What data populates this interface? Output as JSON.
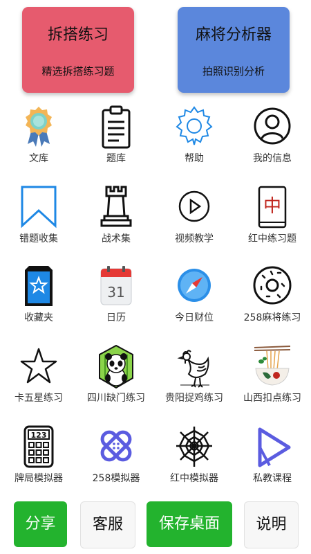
{
  "hero": {
    "left": {
      "title": "拆搭练习",
      "subtitle": "精选拆搭练习题",
      "color": "#e65b6e"
    },
    "right": {
      "title": "麻将分析器",
      "subtitle": "拍照识别分析",
      "color": "#5b87dc"
    }
  },
  "grid": {
    "items": [
      {
        "label": "文库",
        "icon": "award-ribbon-icon"
      },
      {
        "label": "题库",
        "icon": "clipboard-icon"
      },
      {
        "label": "帮助",
        "icon": "gear-icon"
      },
      {
        "label": "我的信息",
        "icon": "user-avatar-icon"
      },
      {
        "label": "错题收集",
        "icon": "bookmark-icon"
      },
      {
        "label": "战术集",
        "icon": "chess-rook-icon"
      },
      {
        "label": "视频教学",
        "icon": "play-circle-icon"
      },
      {
        "label": "红中练习题",
        "icon": "mahjong-tile-icon"
      },
      {
        "label": "收藏夹",
        "icon": "star-card-icon"
      },
      {
        "label": "日历",
        "icon": "calendar-icon"
      },
      {
        "label": "今日财位",
        "icon": "compass-icon"
      },
      {
        "label": "258麻将练习",
        "icon": "donut-icon"
      },
      {
        "label": "卡五星练习",
        "icon": "star-outline-icon"
      },
      {
        "label": "四川缺门练习",
        "icon": "panda-icon"
      },
      {
        "label": "贵阳捉鸡练习",
        "icon": "rooster-icon"
      },
      {
        "label": "山西扣点练习",
        "icon": "noodle-bowl-icon"
      },
      {
        "label": "牌局模拟器",
        "icon": "calculator-icon"
      },
      {
        "label": "258模拟器",
        "icon": "bandage-icon"
      },
      {
        "label": "红中模拟器",
        "icon": "spider-web-icon"
      },
      {
        "label": "私教课程",
        "icon": "play-triangle-icon"
      }
    ],
    "calendar_day": "31",
    "mahjong_char": "中",
    "calculator_digits": "123"
  },
  "bottom": {
    "share": "分享",
    "service": "客服",
    "save_desktop": "保存桌面",
    "instructions": "说明"
  },
  "colors": {
    "green": "#23b32e",
    "accent_blue": "#1e88e5",
    "purple": "#5b5ce0"
  }
}
